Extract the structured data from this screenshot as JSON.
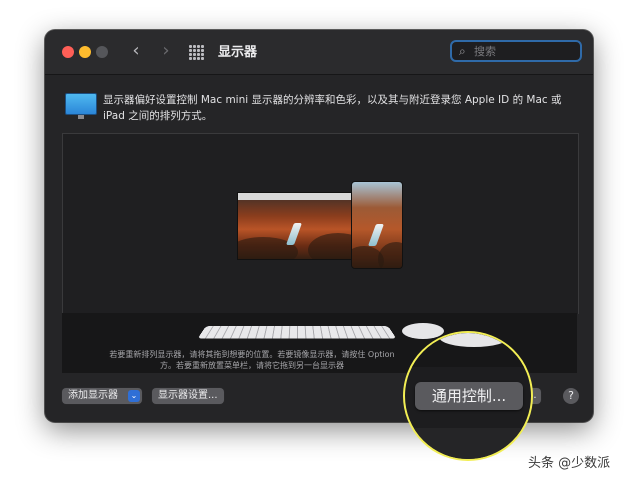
{
  "window": {
    "title": "显示器",
    "nav_back": "‹",
    "nav_forward": "›"
  },
  "search": {
    "placeholder": "搜索",
    "value": ""
  },
  "info": {
    "description": "显示器偏好设置控制 Mac mini 显示器的分辨率和色彩，以及其与附近登录您 Apple ID 的 Mac 或 iPad 之间的排列方式。"
  },
  "arrangement": {
    "hint": "若要重新排列显示器，请将其拖到想要的位置。若要镜像显示器，请按住 Option 方。若要重新放置菜单栏，请将它拖到另一台显示器"
  },
  "buttons": {
    "add_display": "添加显示器",
    "add_display_chevron": "⌄",
    "display_settings": "显示器设置...",
    "partial_button": "...",
    "help": "?"
  },
  "magnified": {
    "universal_control": "通用控制..."
  },
  "watermark": {
    "text": "头条 @少数派"
  },
  "colors": {
    "window_bg": "#252527",
    "accent_blue": "#2f6fd6",
    "highlight_ring": "#f2ee54"
  },
  "icons": {
    "close": "close-icon",
    "minimize": "minimize-icon",
    "zoom": "zoom-icon",
    "grid": "grid-icon",
    "search": "search-icon",
    "display": "display-icon"
  }
}
